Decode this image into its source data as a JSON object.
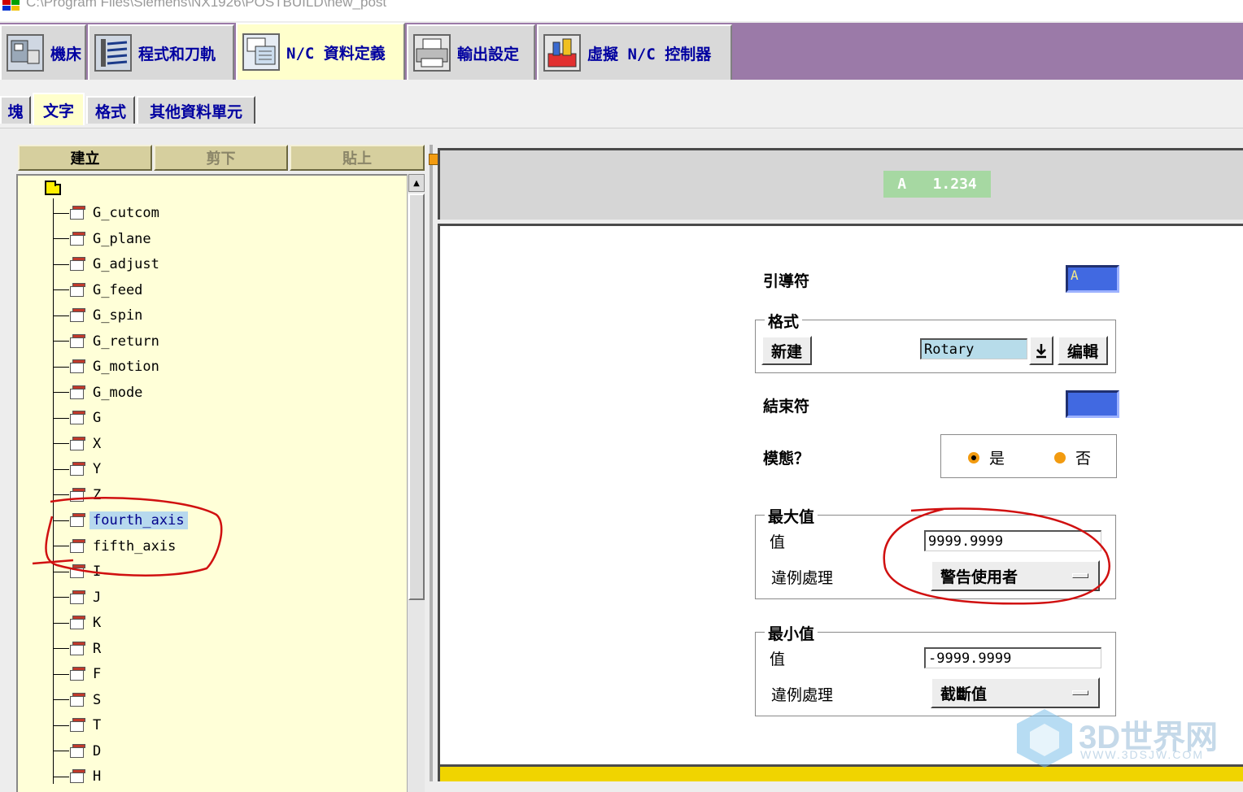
{
  "window": {
    "title": "C:\\Program Files\\Siemens\\NX1926\\POSTBUILD\\new_post"
  },
  "main_tabs": [
    {
      "label": "機床",
      "icon": "machine-tool-icon"
    },
    {
      "label": "程式和刀軌",
      "icon": "program-toolpath-icon"
    },
    {
      "label": "N/C 資料定義",
      "icon": "nc-data-definition-icon",
      "active": true
    },
    {
      "label": "輸出設定",
      "icon": "printer-icon"
    },
    {
      "label": "虛擬 N/C 控制器",
      "icon": "virtual-controller-icon"
    }
  ],
  "sub_tabs": [
    {
      "label": "塊"
    },
    {
      "label": "文字",
      "active": true
    },
    {
      "label": "格式"
    },
    {
      "label": "其他資料單元"
    }
  ],
  "toolbar": {
    "create": "建立",
    "cut": "剪下",
    "paste": "貼上"
  },
  "tree": {
    "items": [
      "G_cutcom",
      "G_plane",
      "G_adjust",
      "G_feed",
      "G_spin",
      "G_return",
      "G_motion",
      "G_mode",
      "G",
      "X",
      "Y",
      "Z",
      "fourth_axis",
      "fifth_axis",
      "I",
      "J",
      "K",
      "R",
      "F",
      "S",
      "T",
      "D",
      "H"
    ],
    "selected": "fourth_axis"
  },
  "preview": {
    "text": "A   1.234"
  },
  "form": {
    "leader_label": "引導符",
    "leader_value": "A",
    "format_group": "格式",
    "new_button": "新建",
    "format_value": "Rotary",
    "edit_button": "编輯",
    "trailer_label": "結束符",
    "trailer_value": "",
    "modal_label": "模態？",
    "modal_yes": "是",
    "modal_no": "否",
    "modal_selected": "是",
    "max_group": "最大值",
    "max_value_label": "值",
    "max_value": "9999.9999",
    "max_violation_label": "違例處理",
    "max_violation": "警告使用者",
    "min_group": "最小值",
    "min_value_label": "值",
    "min_value": "-9999.9999",
    "min_violation_label": "違例處理",
    "min_violation": "截斷值"
  },
  "watermark": {
    "brand": "3D世界网",
    "url": "WWW.3DSJW.COM"
  },
  "colors": {
    "tab_bar": "#9b7aa8",
    "active_tab": "#ffffcc",
    "tree_bg": "#ffffd8",
    "selection": "#b7d9ee",
    "entry_color_box": "#4169e1",
    "preview_green": "#a6d8a2",
    "annotation_red": "#d01010"
  }
}
